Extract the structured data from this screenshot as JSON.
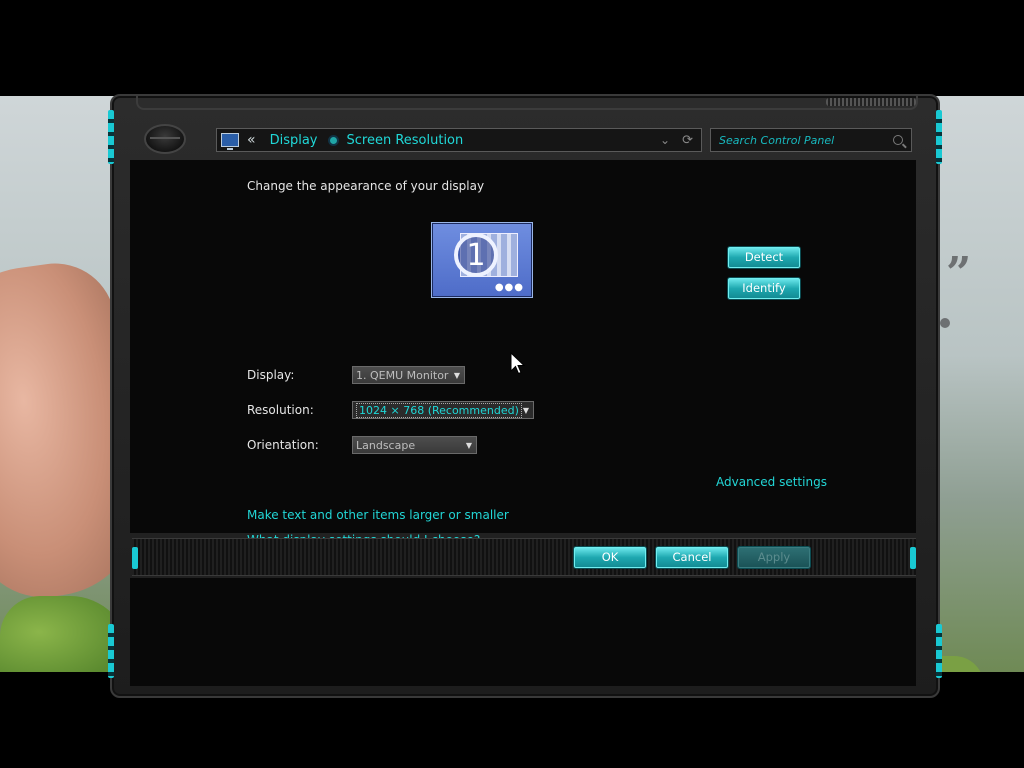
{
  "window": {
    "breadcrumb": {
      "back_symbol": "«",
      "items": [
        "Display",
        "Screen Resolution"
      ]
    },
    "search": {
      "placeholder": "Search Control Panel"
    }
  },
  "main": {
    "heading": "Change the appearance of your display",
    "monitor_number": "1",
    "detect_label": "Detect",
    "identify_label": "Identify",
    "display": {
      "label": "Display:",
      "value": "1. QEMU Monitor"
    },
    "resolution": {
      "label": "Resolution:",
      "value": "1024 × 768 (Recommended)"
    },
    "orientation": {
      "label": "Orientation:",
      "value": "Landscape"
    },
    "advanced_link": "Advanced settings",
    "links": [
      "Make text and other items larger or smaller",
      "What display settings should I choose?"
    ]
  },
  "footer": {
    "ok_label": "OK",
    "cancel_label": "Cancel",
    "apply_label": "Apply"
  },
  "wallpaper": {
    "quote_glyph": "”"
  },
  "colors": {
    "accent": "#20d8d8",
    "frame": "#1d1d1d",
    "content_bg": "#080808"
  }
}
